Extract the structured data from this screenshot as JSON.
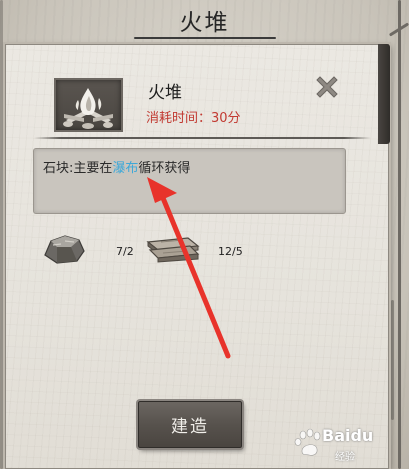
{
  "screen": {
    "title": "火堆"
  },
  "item": {
    "name": "火堆",
    "build_time": "消耗时间：30分",
    "thumb_icon": "campfire-icon"
  },
  "description": {
    "prefix": "石块:主要在",
    "highlight": "瀑布",
    "suffix": "循环获得",
    "highlight_color": "#3ea8d8"
  },
  "materials": [
    {
      "icon": "stone-icon",
      "count": "7/2"
    },
    {
      "icon": "wood-planks-icon",
      "count": "12/5"
    }
  ],
  "actions": {
    "close_icon": "close-icon",
    "build_label": "建造"
  },
  "annotation": {
    "arrow_color": "#e8332b"
  },
  "watermark": {
    "brand": "Baidu",
    "sub": "经验"
  },
  "colors": {
    "build_time_red": "#c23a32",
    "panel_paper": "#e8e5df",
    "button_dark": "#57524d"
  }
}
